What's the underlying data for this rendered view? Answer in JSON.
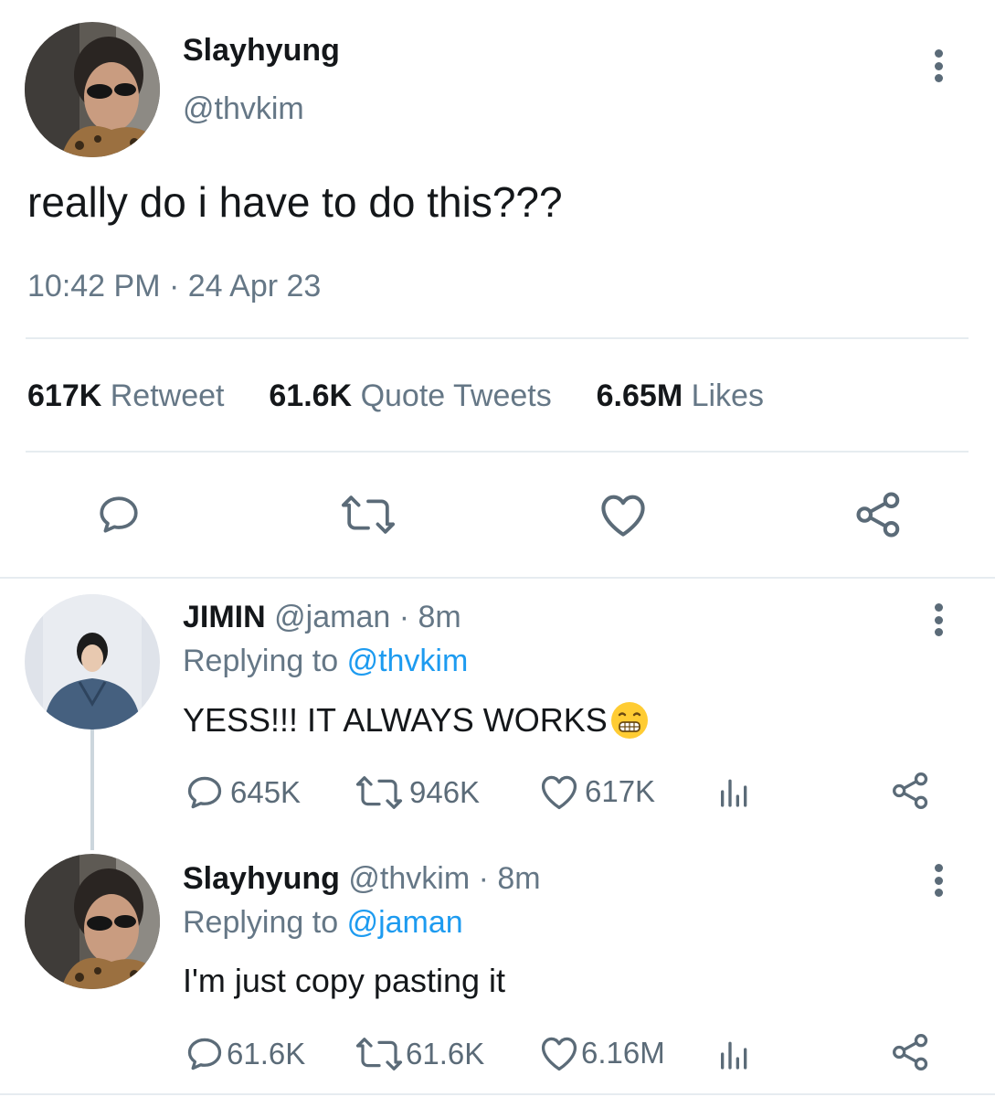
{
  "main_tweet": {
    "display_name": "Slayhyung",
    "handle": "@thvkim",
    "text": "really do i have to do this???",
    "time": "10:42 PM",
    "separator": "·",
    "date": "24 Apr 23",
    "stats": {
      "retweets_count": "617K",
      "retweets_label": "Retweet",
      "quotes_count": "61.6K",
      "quotes_label": "Quote Tweets",
      "likes_count": "6.65M",
      "likes_label": "Likes"
    }
  },
  "replies": [
    {
      "display_name": "JIMIN",
      "handle": "@jaman",
      "time": "· 8m",
      "replying_prefix": "Replying to",
      "replying_to": "@thvkim",
      "text": "YESS!!! IT ALWAYS WORKS",
      "emoji": "grinning-face-emoji",
      "reply_count": "645K",
      "retweet_count": "946K",
      "like_count": "617K"
    },
    {
      "display_name": "Slayhyung",
      "handle": "@thvkim",
      "time": "· 8m",
      "replying_prefix": "Replying to",
      "replying_to": "@jaman",
      "text": "I'm just copy pasting it",
      "reply_count": "61.6K",
      "retweet_count": "61.6K",
      "like_count": "6.16M"
    }
  ],
  "icons": [
    "reply-icon",
    "retweet-icon",
    "like-icon",
    "share-icon",
    "analytics-icon",
    "more-icon"
  ],
  "colors": {
    "text": "#14171a",
    "muted": "#657786",
    "link": "#1d9bf0",
    "divider": "#e6ecf0"
  }
}
